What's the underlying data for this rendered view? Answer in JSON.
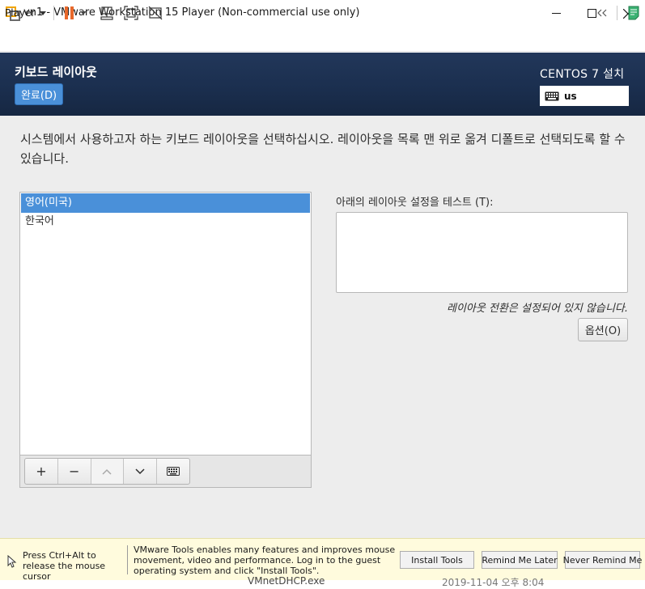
{
  "window": {
    "title": "vn1 - VMware Workstation 15 Player (Non-commercial use only)",
    "minimize_icon": "minimize-icon",
    "maximize_icon": "maximize-icon",
    "close_icon": "close-icon"
  },
  "toolbar": {
    "player_label": "Player",
    "buttons": [
      "pause-icon",
      "send-ctrl-alt-del-icon",
      "fit-guest-icon",
      "unity-icon",
      "collapse-toolbar-icon",
      "notes-icon"
    ]
  },
  "header": {
    "spoke_title": "키보드 레이아웃",
    "done_label": "완료(D)",
    "install_title": "CENTOS 7 설치",
    "layout_code": "us"
  },
  "body": {
    "instruction": "시스템에서 사용하고자 하는 키보드 레이아웃을 선택하십시오. 레이아웃을 목록 맨 위로 옮겨 디폴트로 선택되도록 할 수 있습니다.",
    "layouts": [
      {
        "label": "영어(미국)",
        "selected": true
      },
      {
        "label": "한국어",
        "selected": false
      }
    ],
    "list_buttons": {
      "add": "+",
      "remove": "−",
      "up": "∧",
      "down": "∨"
    },
    "test_label": "아래의 레이아웃 설정을 테스트 (T):",
    "test_value": "",
    "switch_status": "레이아웃 전환은 설정되어 있지 않습니다.",
    "options_label": "옵션(O)"
  },
  "notification": {
    "release_hint": "Press Ctrl+Alt to release the mouse cursor",
    "tools_message": "VMware Tools enables many features and improves mouse movement, video and performance. Log in to the guest operating system and click \"Install Tools\".",
    "install_tools": "Install Tools",
    "remind_later": "Remind Me Later",
    "never_remind": "Never Remind Me"
  },
  "host_behind": {
    "file_name": "VMnetDHCP.exe",
    "date": "2019-11-04 오후 8:04"
  },
  "colors": {
    "header_bg": "#1b2f4f",
    "accent": "#4a90d9",
    "pause": "#e8692c",
    "notification_bg": "#fffbdd"
  }
}
